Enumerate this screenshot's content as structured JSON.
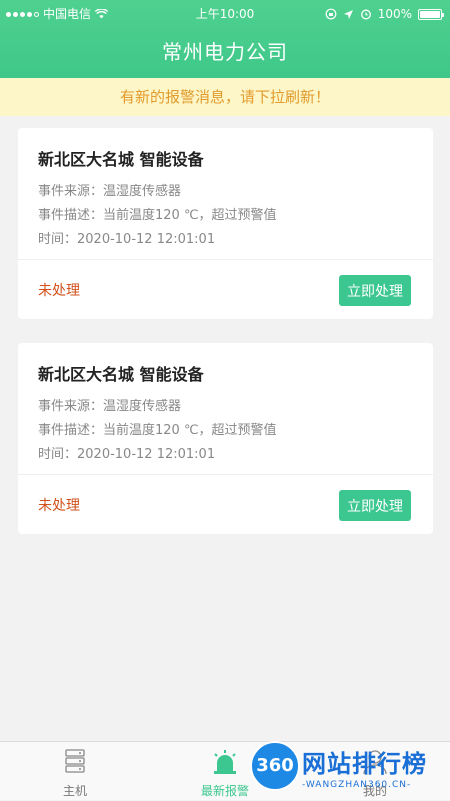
{
  "status_bar": {
    "carrier": "中国电信",
    "time": "上午10:00",
    "battery": "100%"
  },
  "header": {
    "title": "常州电力公司"
  },
  "banner": {
    "text": "有新的报警消息，请下拉刷新！"
  },
  "alarms": [
    {
      "title": "新北区大名城  智能设备",
      "source_label": "事件来源：",
      "source_value": "温湿度传感器",
      "desc_label": "事件描述：",
      "desc_value": "当前温度120 ℃，超过预警值",
      "time_label": "时间：",
      "time_value": "2020-10-12 12:01:01",
      "status": "未处理",
      "action_label": "立即处理"
    },
    {
      "title": "新北区大名城  智能设备",
      "source_label": "事件来源：",
      "source_value": "温湿度传感器",
      "desc_label": "事件描述：",
      "desc_value": "当前温度120 ℃，超过预警值",
      "time_label": "时间：",
      "time_value": "2020-10-12 12:01:01",
      "status": "未处理",
      "action_label": "立即处理"
    }
  ],
  "tabbar": {
    "tabs": [
      {
        "label": "主机",
        "icon": "server-icon"
      },
      {
        "label": "最新报警",
        "icon": "alarm-icon"
      },
      {
        "label": "我的",
        "icon": "user-icon"
      }
    ]
  },
  "watermark": {
    "badge": "360",
    "text": "网站排行榜",
    "sub": "-WANGZHAN360.CN-"
  },
  "colors": {
    "header": "#3fc88a",
    "accent": "#3cc790",
    "status_pending": "#d2501b",
    "banner_bg": "#fdf6c8",
    "banner_text": "#e29b2c"
  }
}
